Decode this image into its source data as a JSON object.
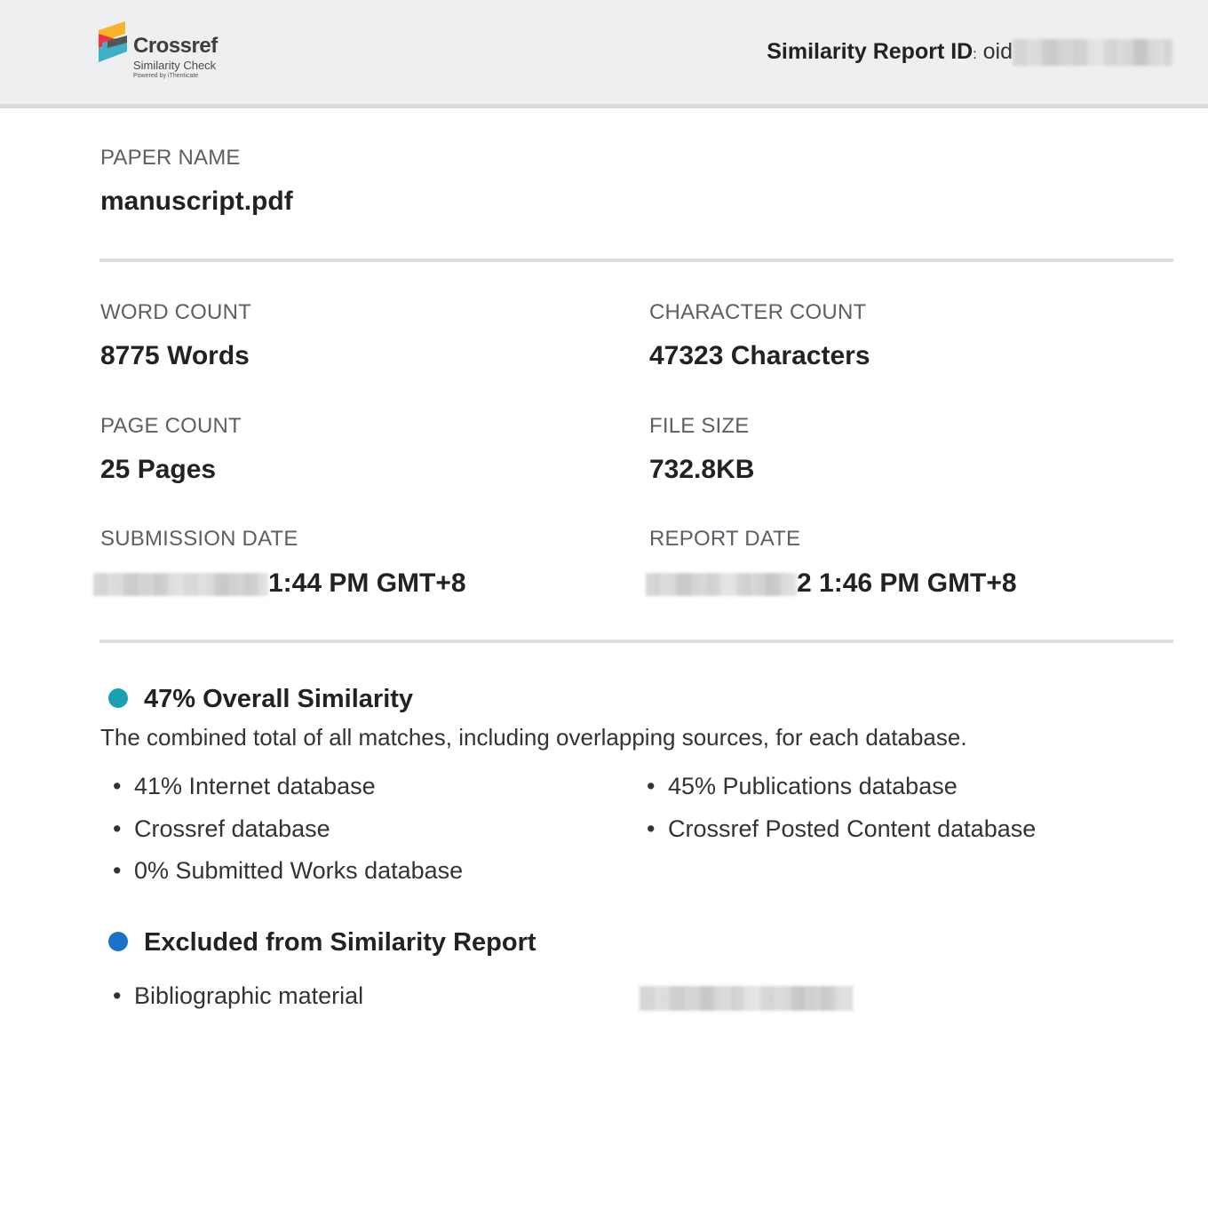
{
  "header": {
    "brand": "Crossref",
    "brand_sub": "Similarity Check",
    "brand_powered": "Powered by iThenticate",
    "report_id_label": "Similarity Report ID",
    "report_id_colon": ":",
    "report_id_value": "oid"
  },
  "paper": {
    "name_label": "PAPER NAME",
    "name_value": "manuscript.pdf"
  },
  "stats": {
    "word_count_label": "WORD COUNT",
    "word_count_value": "8775 Words",
    "character_count_label": "CHARACTER COUNT",
    "character_count_value": "47323 Characters",
    "page_count_label": "PAGE COUNT",
    "page_count_value": "25 Pages",
    "file_size_label": "FILE SIZE",
    "file_size_value": "732.8KB",
    "submission_date_label": "SUBMISSION DATE",
    "submission_date_value": "1:44 PM GMT+8",
    "report_date_label": "REPORT DATE",
    "report_date_value": "2 1:46 PM GMT+8"
  },
  "similarity": {
    "title": "47% Overall Similarity",
    "description": "The combined total of all matches, including overlapping sources, for each database.",
    "dot_color": "#1aa0b3",
    "items_left": [
      "41% Internet database",
      "Crossref database",
      "0% Submitted Works database"
    ],
    "items_right": [
      "45% Publications database",
      "Crossref Posted Content database"
    ]
  },
  "excluded": {
    "title": "Excluded from Similarity Report",
    "dot_color": "#1a73c9",
    "items": [
      "Bibliographic material"
    ]
  }
}
